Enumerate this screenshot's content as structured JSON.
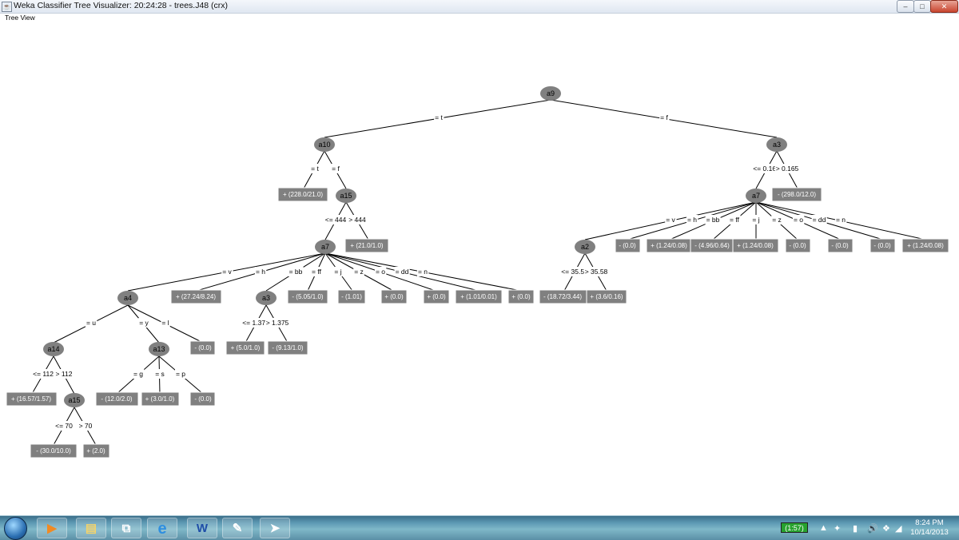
{
  "window": {
    "title": "Weka Classifier Tree Visualizer: 20:24:28 - trees.J48 (crx)",
    "panel_label": "Tree View",
    "minimize": "–",
    "maximize": "□",
    "close": "✕"
  },
  "tree": {
    "nodes": {
      "root": "a9",
      "n_a10": "a10",
      "n_a3r": "a3",
      "n_a15": "a15",
      "n_a7l": "a7",
      "n_a7r": "a7",
      "n_a4": "a4",
      "n_a3m": "a3",
      "n_a14": "a14",
      "n_a13": "a13",
      "n_a15b": "a15",
      "n_a2": "a2"
    },
    "leaves": {
      "l1": "+ (228.0/21.0)",
      "l2": "+ (21.0/1.0)",
      "l3": "+ (27.24/8.24)",
      "l4": "- (5.05/1.0)",
      "l5": "- (1.01)",
      "l6": "+ (0.0)",
      "l7": "+ (0.0)",
      "l8": "+ (1.01/0.01)",
      "l9": "+ (0.0)",
      "l10": "- (0.0)",
      "l11": "+ (5.0/1.0)",
      "l12": "- (9.13/1.0)",
      "l13": "+ (16.57/1.57)",
      "l14": "- (12.0/2.0)",
      "l15": "+ (3.0/1.0)",
      "l16": "- (0.0)",
      "l17": "- (30.0/10.0)",
      "l18": "+ (2.0)",
      "l19": "- (298.0/12.0)",
      "l20": "- (18.72/3.44)",
      "l21": "+ (3.6/0.16)",
      "l22": "- (0.0)",
      "l23": "+ (1.24/0.08)",
      "l24": "- (4.96/0.64)",
      "l25": "+ (1.24/0.08)",
      "l26": "- (0.0)",
      "l27": "- (0.0)",
      "l28": "- (0.0)",
      "l29": "+ (1.24/0.08)"
    },
    "edges": {
      "e1": "= t",
      "e2": "= f",
      "e3": "= t",
      "e4": "= f",
      "e5": "<= 444",
      "e6": "> 444",
      "e7": "= v",
      "e8": "= h",
      "e9": "= bb",
      "e10": "= ff",
      "e11": "= j",
      "e12": "= z",
      "e13": "= o",
      "e14": "= dd",
      "e15": "= n",
      "e16": "= u",
      "e17": "= y",
      "e18": "= l",
      "e19": "<= 1.375",
      "e20": "> 1.375",
      "e21": "<= 112",
      "e22": "> 112",
      "e23": "= g",
      "e24": "= s",
      "e25": "= p",
      "e26": "<= 70",
      "e27": "> 70",
      "e28": "<= 0.165",
      "e29": "> 0.165",
      "e30": "= v",
      "e31": "= h",
      "e32": "= bb",
      "e33": "= ff",
      "e34": "= j",
      "e35": "= z",
      "e36": "= o",
      "e37": "= dd",
      "e38": "= n",
      "e39": "<= 35.58",
      "e40": "> 35.58"
    }
  },
  "taskbar": {
    "battery": "(1:57)",
    "time": "8:24 PM",
    "date": "10/14/2013",
    "apps": [
      "media-player",
      "file-explorer",
      "remote-desktop",
      "internet-explorer",
      "word",
      "paint",
      "thunderbird"
    ],
    "app_glyphs": [
      "▶",
      "▤",
      "⧉",
      "e",
      "W",
      "✎",
      "➤"
    ]
  },
  "colors": {
    "node_fill": "#808080",
    "leaf_fill": "#808080",
    "leaf_text": "#ffffff",
    "edge": "#000000"
  }
}
